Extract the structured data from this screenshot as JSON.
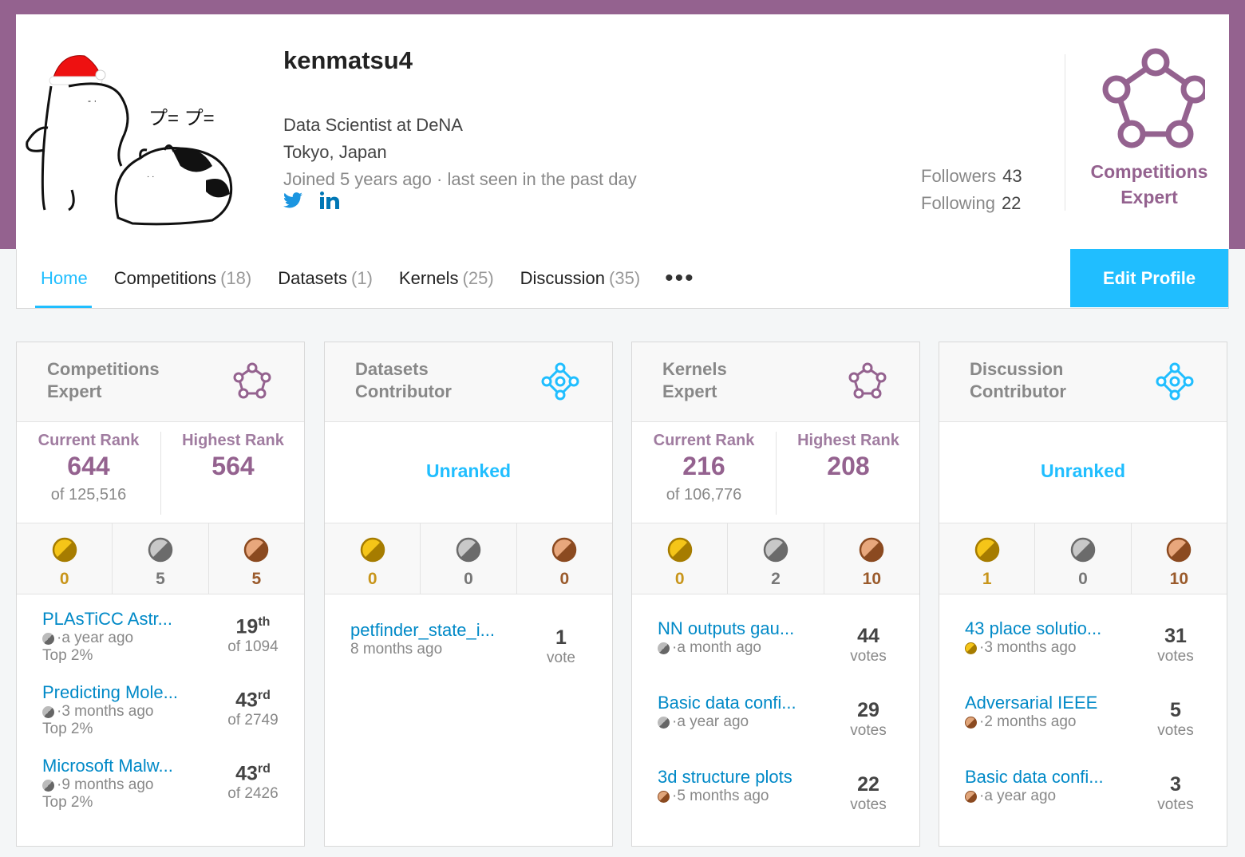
{
  "profile": {
    "username": "kenmatsu4",
    "occupation": "Data Scientist at DeNA",
    "location": "Tokyo, Japan",
    "joined": "Joined 5 years ago · last seen in the past day",
    "followers_label": "Followers",
    "followers": "43",
    "following_label": "Following",
    "following": "22",
    "tier_label_1": "Competitions",
    "tier_label_2": "Expert",
    "avatar_text": "プ= プ="
  },
  "tabs": [
    {
      "label": "Home",
      "count": ""
    },
    {
      "label": "Competitions",
      "count": "(18)"
    },
    {
      "label": "Datasets",
      "count": "(1)"
    },
    {
      "label": "Kernels",
      "count": "(25)"
    },
    {
      "label": "Discussion",
      "count": "(35)"
    }
  ],
  "more_label": "•••",
  "edit_profile": "Edit Profile",
  "cards": [
    {
      "title1": "Competitions",
      "title2": "Expert",
      "current_rank_label": "Current Rank",
      "current_rank": "644",
      "of": "of 125,516",
      "highest_rank_label": "Highest Rank",
      "highest_rank": "564",
      "gold": "0",
      "silver": "5",
      "bronze": "5",
      "items": [
        {
          "title": "PLAsTiCC Astr...",
          "meta": "·a year ago",
          "sub": "Top 2%",
          "rank": "19",
          "suffix": "th",
          "of": "of 1094"
        },
        {
          "title": "Predicting Mole...",
          "meta": "·3 months ago",
          "sub": "Top 2%",
          "rank": "43",
          "suffix": "rd",
          "of": "of 2749"
        },
        {
          "title": "Microsoft Malw...",
          "meta": "·9 months ago",
          "sub": "Top 2%",
          "rank": "43",
          "suffix": "rd",
          "of": "of 2426"
        }
      ]
    },
    {
      "title1": "Datasets",
      "title2": "Contributor",
      "unranked": "Unranked",
      "gold": "0",
      "silver": "0",
      "bronze": "0",
      "items": [
        {
          "title": "petfinder_state_i...",
          "meta": "8 months ago",
          "votes": "1",
          "votes_label": "vote"
        }
      ]
    },
    {
      "title1": "Kernels",
      "title2": "Expert",
      "current_rank_label": "Current Rank",
      "current_rank": "216",
      "of": "of 106,776",
      "highest_rank_label": "Highest Rank",
      "highest_rank": "208",
      "gold": "0",
      "silver": "2",
      "bronze": "10",
      "items": [
        {
          "title": "NN outputs gau...",
          "meta": "·a month ago",
          "votes": "44",
          "votes_label": "votes"
        },
        {
          "title": "Basic data confi...",
          "meta": "·a year ago",
          "votes": "29",
          "votes_label": "votes"
        },
        {
          "title": "3d structure plots",
          "meta": "·5 months ago",
          "votes": "22",
          "votes_label": "votes"
        }
      ]
    },
    {
      "title1": "Discussion",
      "title2": "Contributor",
      "unranked": "Unranked",
      "gold": "1",
      "silver": "0",
      "bronze": "10",
      "items": [
        {
          "title": "43 place solutio...",
          "meta": "·3 months ago",
          "votes": "31",
          "votes_label": "votes"
        },
        {
          "title": "Adversarial IEEE",
          "meta": "·2 months ago",
          "votes": "5",
          "votes_label": "votes"
        },
        {
          "title": "Basic data confi...",
          "meta": "·a year ago",
          "votes": "3",
          "votes_label": "votes"
        }
      ]
    }
  ]
}
